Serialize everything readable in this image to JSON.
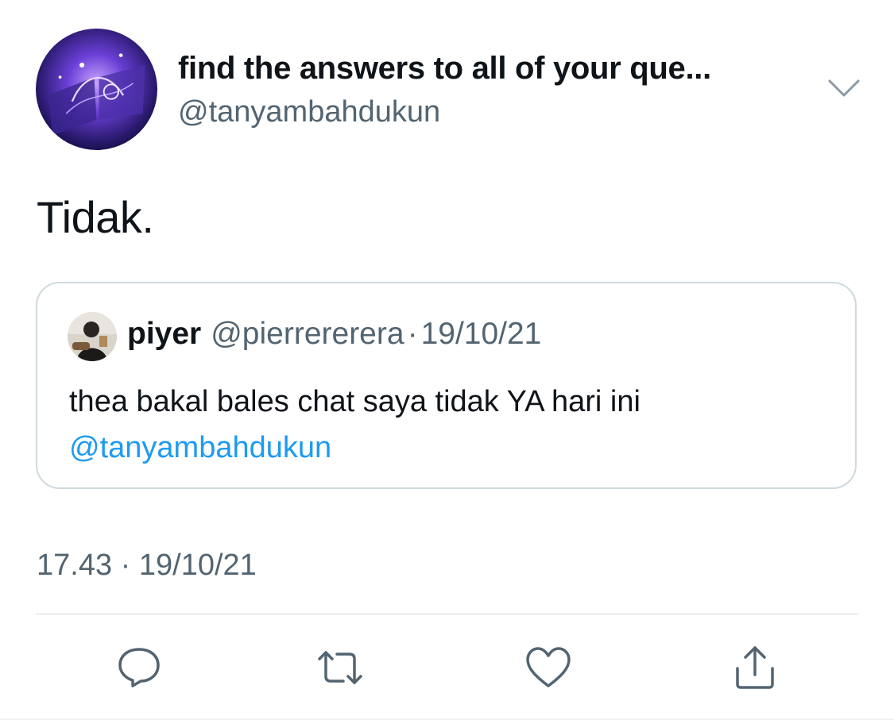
{
  "tweet": {
    "author": {
      "display_name": "find the answers to all of your que...",
      "handle": "@tanyambahdukun",
      "avatar_icon": "magic-book-avatar"
    },
    "text": "Tidak.",
    "quoted": {
      "author_name": "piyer",
      "author_handle": "@pierrererera",
      "separator": "·",
      "date": "19/10/21",
      "text": "thea bakal bales chat saya tidak YA hari ini",
      "mention": "@tanyambahdukun",
      "avatar_icon": "person-photo-avatar"
    },
    "time": "17.43",
    "meta_separator": "·",
    "date": "19/10/21"
  },
  "actions": [
    {
      "icon": "reply-icon"
    },
    {
      "icon": "retweet-icon"
    },
    {
      "icon": "like-icon"
    },
    {
      "icon": "share-icon"
    }
  ],
  "colors": {
    "text_primary": "#0f1419",
    "text_secondary": "#536471",
    "link": "#1d9bf0",
    "border": "#cfd9de"
  }
}
